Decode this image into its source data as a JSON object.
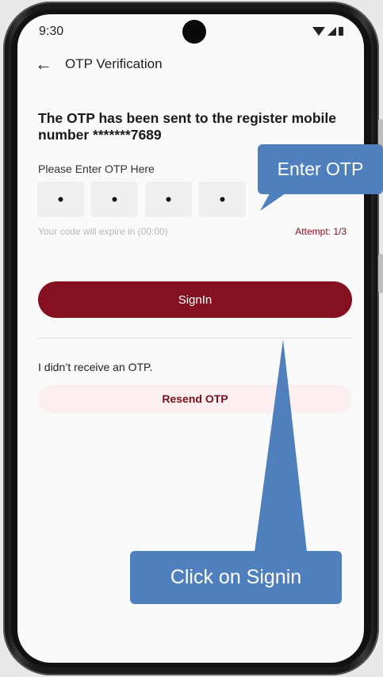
{
  "status_bar": {
    "time": "9:30"
  },
  "nav": {
    "title": "OTP Verification"
  },
  "heading": "The OTP has been sent to the register mobile number *******7689",
  "otp": {
    "label": "Please Enter OTP Here",
    "digits": [
      "•",
      "•",
      "•",
      "•"
    ],
    "expire_text": "Your code will expire in (00:00)",
    "attempt_text": "Attempt: 1/3"
  },
  "signin_label": "SignIn",
  "resend": {
    "prompt": "I didn’t receive an OTP.",
    "button_label": "Resend OTP"
  },
  "annotations": {
    "enter_otp": "Enter OTP",
    "click_signin": "Click on Signin"
  },
  "colors": {
    "primary": "#85101f",
    "resend_bg": "#fbeff0",
    "callout": "#4f80bd"
  },
  "icons": [
    "back-arrow-icon",
    "wifi-icon",
    "signal-icon",
    "battery-icon",
    "camera-icon"
  ]
}
